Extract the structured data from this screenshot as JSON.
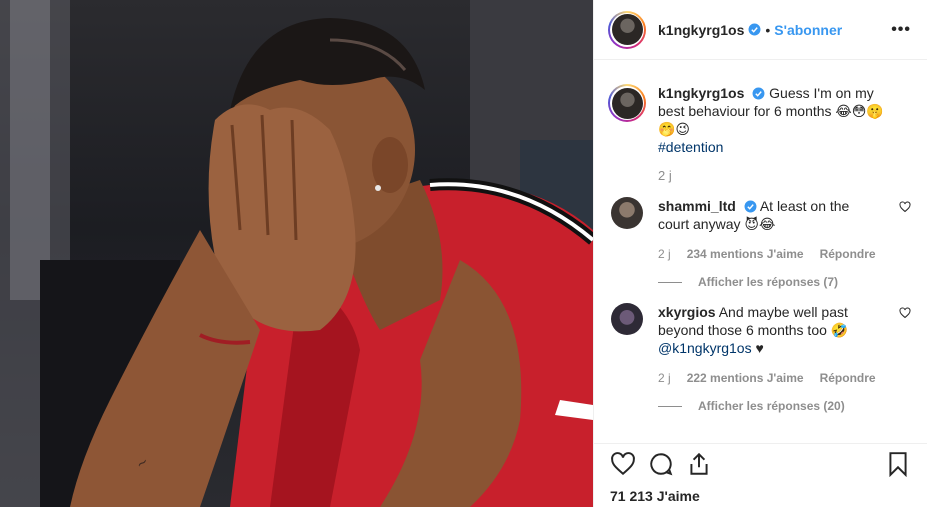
{
  "header": {
    "username": "k1ngkyrg1os",
    "separator": "•",
    "follow_label": "S'abonner",
    "more_label": "•••"
  },
  "caption": {
    "username": "k1ngkyrg1os",
    "text": "Guess I'm on my best behaviour for 6 months 😂😳🤫🤭😉",
    "hashtag": "#detention",
    "time": "2 j"
  },
  "comments": [
    {
      "username": "shammi_ltd",
      "text": "At least on the court anyway 😈😂",
      "time": "2 j",
      "likes": "234 mentions J'aime",
      "reply": "Répondre",
      "view_replies": "Afficher les réponses (7)"
    },
    {
      "username": "xkyrgios",
      "text": "And maybe well past beyond those 6 months too 🤣",
      "mention": "@k1ngkyrg1os",
      "heart": "♥",
      "time": "2 j",
      "likes": "222 mentions J'aime",
      "reply": "Répondre",
      "view_replies": "Afficher les réponses (20)"
    }
  ],
  "footer": {
    "likes": "71 213 J'aime"
  },
  "colors": {
    "accent": "#3897f0",
    "jersey": "#c8202c",
    "muted": "#8e8e8e"
  }
}
